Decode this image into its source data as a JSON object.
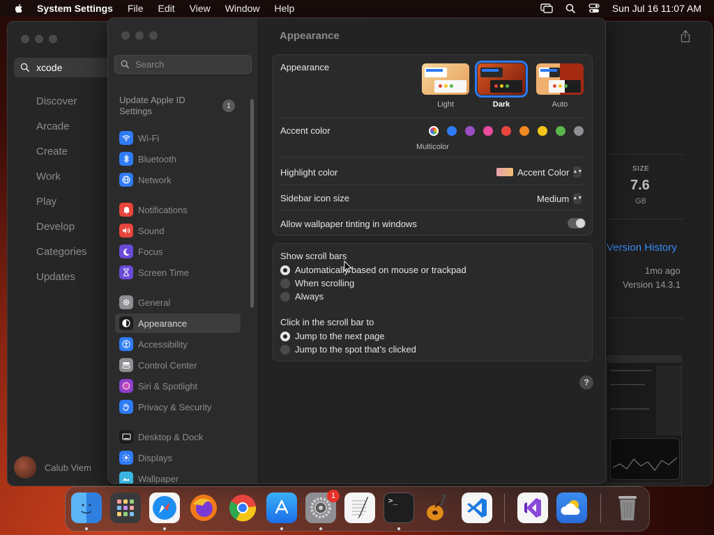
{
  "menubar": {
    "app_name": "System Settings",
    "items": [
      "File",
      "Edit",
      "View",
      "Window",
      "Help"
    ],
    "datetime": "Sun Jul 16  11:07 AM"
  },
  "appstore": {
    "search_value": "xcode",
    "nav": [
      "Discover",
      "Arcade",
      "Create",
      "Work",
      "Play",
      "Develop",
      "Categories",
      "Updates"
    ],
    "user_name": "Calub Viem",
    "size_label": "SIZE",
    "size_value": "7.6",
    "size_unit": "GB",
    "version_history": "Version History",
    "updated_ago": "1mo ago",
    "version": "Version 14.3.1"
  },
  "settings": {
    "search_placeholder": "Search",
    "apple_id": "Update Apple ID Settings",
    "apple_id_badge": "1",
    "sidebar": [
      {
        "label": "Wi-Fi",
        "icon": "wifi-icon",
        "color": "#2f7bf5"
      },
      {
        "label": "Bluetooth",
        "icon": "bluetooth-icon",
        "color": "#2f7bf5"
      },
      {
        "label": "Network",
        "icon": "globe-icon",
        "color": "#2f7bf5"
      },
      {
        "label": "Notifications",
        "icon": "bell-icon",
        "color": "#e8453c"
      },
      {
        "label": "Sound",
        "icon": "speaker-icon",
        "color": "#e8453c"
      },
      {
        "label": "Focus",
        "icon": "moon-icon",
        "color": "#6a4bd8"
      },
      {
        "label": "Screen Time",
        "icon": "hourglass-icon",
        "color": "#6a4bd8"
      },
      {
        "label": "General",
        "icon": "gear-icon",
        "color": "#8e8e93"
      },
      {
        "label": "Appearance",
        "icon": "appearance-icon",
        "color": "#1c1c1e"
      },
      {
        "label": "Accessibility",
        "icon": "accessibility-icon",
        "color": "#2f7bf5"
      },
      {
        "label": "Control Center",
        "icon": "control-center-icon",
        "color": "#8e8e93"
      },
      {
        "label": "Siri & Spotlight",
        "icon": "siri-icon",
        "color": "#b04ad6"
      },
      {
        "label": "Privacy & Security",
        "icon": "hand-icon",
        "color": "#2f7bf5"
      },
      {
        "label": "Desktop & Dock",
        "icon": "desktop-icon",
        "color": "#1c1c1e"
      },
      {
        "label": "Displays",
        "icon": "display-icon",
        "color": "#2f7bf5"
      },
      {
        "label": "Wallpaper",
        "icon": "wallpaper-icon",
        "color": "#3ab4e0"
      }
    ],
    "selected": "Appearance",
    "page_title": "Appearance",
    "appearance_label": "Appearance",
    "modes": [
      "Light",
      "Dark",
      "Auto"
    ],
    "selected_mode": "Dark",
    "accent_label": "Accent color",
    "accent_colors": [
      "multicolor",
      "#2f7bf5",
      "#9b4fc4",
      "#e84b9c",
      "#e8453c",
      "#f08a24",
      "#f5c518",
      "#5ab54a",
      "#8e8e93"
    ],
    "accent_caption": "Multicolor",
    "highlight_label": "Highlight color",
    "highlight_value": "Accent Color",
    "sidebar_icon_label": "Sidebar icon size",
    "sidebar_icon_value": "Medium",
    "tinting_label": "Allow wallpaper tinting in windows",
    "tinting_on": false,
    "scrollbars_label": "Show scroll bars",
    "scrollbar_options": [
      "Automatically based on mouse or trackpad",
      "When scrolling",
      "Always"
    ],
    "scrollbar_selected": 0,
    "click_label": "Click in the scroll bar to",
    "click_options": [
      "Jump to the next page",
      "Jump to the spot that’s clicked"
    ],
    "click_selected": 0,
    "help": "?"
  },
  "dock": {
    "apps": [
      "Finder",
      "Launchpad",
      "Safari",
      "Firefox",
      "Chrome",
      "App Store",
      "System Settings",
      "TextEdit",
      "Terminal",
      "GarageBand",
      "Visual Studio Code",
      "Visual Studio",
      "Weather",
      "Trash"
    ],
    "settings_badge": "1"
  }
}
